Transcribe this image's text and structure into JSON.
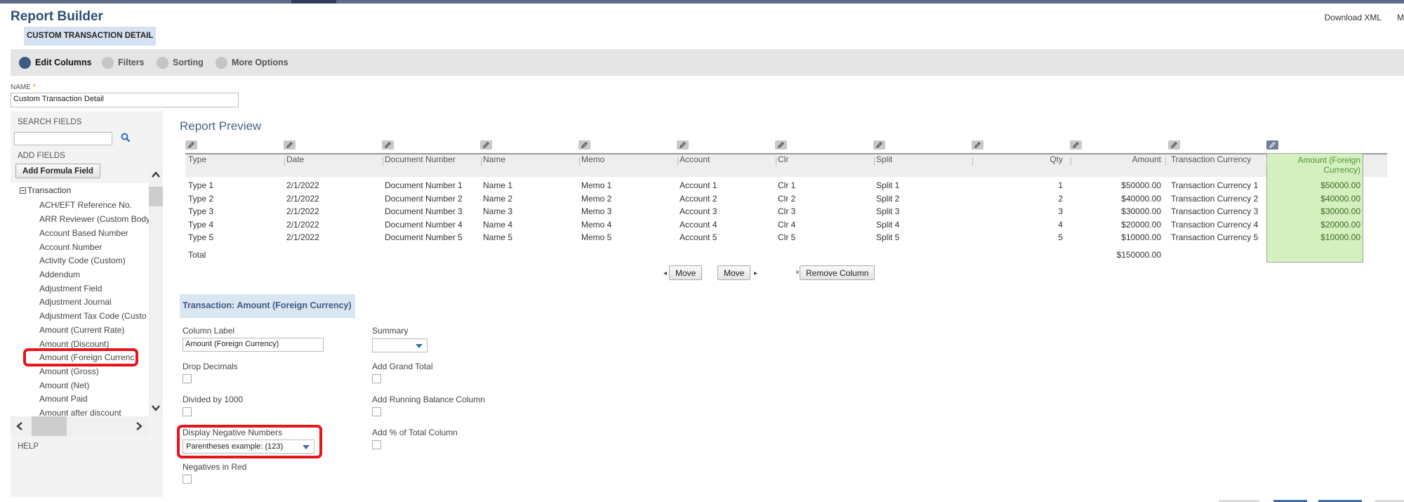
{
  "app": {
    "title": "Report Builder",
    "subtab": "CUSTOM TRANSACTION DETAIL",
    "header_links": [
      "Download XML",
      "M"
    ]
  },
  "steps": [
    {
      "label": "Edit Columns",
      "active": true
    },
    {
      "label": "Filters",
      "active": false
    },
    {
      "label": "Sorting",
      "active": false
    },
    {
      "label": "More Options",
      "active": false
    }
  ],
  "name_field": {
    "label": "NAME",
    "required_mark": "*",
    "value": "Custom Transaction Detail"
  },
  "sidebar": {
    "search_label": "SEARCH FIELDS",
    "search_value": "",
    "add_fields_label": "ADD FIELDS",
    "add_formula_label": "Add Formula Field",
    "group": "Transaction",
    "fields": [
      "ACH/EFT Reference No.",
      "ARR Reviewer (Custom Body",
      "Account Based Number",
      "Account Number",
      "Activity Code (Custom)",
      "Addendum",
      "Adjustment Field",
      "Adjustment Journal",
      "Adjustment Tax Code (Custo",
      "Amount (Current Rate)",
      "Amount (Discount)",
      "Amount (Foreign Currenc",
      "Amount (Gross)",
      "Amount (Net)",
      "Amount Paid",
      "Amount after discount"
    ],
    "help_label": "HELP"
  },
  "preview": {
    "title": "Report Preview",
    "columns": [
      "Type",
      "Date",
      "Document Number",
      "Name",
      "Memo",
      "Account",
      "Clr",
      "Split",
      "Qty",
      "Amount",
      "Transaction Currency",
      "Amount (Foreign Currency)"
    ],
    "selected_column_lines": [
      "Amount (Foreign",
      "Currency)"
    ],
    "rows": [
      [
        "Type 1",
        "2/1/2022",
        "Document Number 1",
        "Name 1",
        "Memo 1",
        "Account 1",
        "Clr 1",
        "Split 1",
        "1",
        "$50000.00",
        "Transaction Currency 1",
        "$50000.00"
      ],
      [
        "Type 2",
        "2/1/2022",
        "Document Number 2",
        "Name 2",
        "Memo 2",
        "Account 2",
        "Clr 2",
        "Split 2",
        "2",
        "$40000.00",
        "Transaction Currency 2",
        "$40000.00"
      ],
      [
        "Type 3",
        "2/1/2022",
        "Document Number 3",
        "Name 3",
        "Memo 3",
        "Account 3",
        "Clr 3",
        "Split 3",
        "3",
        "$30000.00",
        "Transaction Currency 3",
        "$30000.00"
      ],
      [
        "Type 4",
        "2/1/2022",
        "Document Number 4",
        "Name 4",
        "Memo 4",
        "Account 4",
        "Clr 4",
        "Split 4",
        "4",
        "$20000.00",
        "Transaction Currency 4",
        "$20000.00"
      ],
      [
        "Type 5",
        "2/1/2022",
        "Document Number 5",
        "Name 5",
        "Memo 5",
        "Account 5",
        "Clr 5",
        "Split 5",
        "5",
        "$10000.00",
        "Transaction Currency 5",
        "$10000.00"
      ]
    ],
    "total_label": "Total",
    "total_amount": "$150000.00",
    "buttons": {
      "move_left": "Move",
      "move_right": "Move",
      "remove": "Remove Column"
    }
  },
  "column_settings": {
    "section_title": "Transaction: Amount (Foreign Currency)",
    "column_label_label": "Column Label",
    "column_label_value": "Amount (Foreign Currency)",
    "summary_label": "Summary",
    "summary_value": "",
    "drop_decimals_label": "Drop Decimals",
    "add_grand_total_label": "Add Grand Total",
    "divided_label": "Divided by 1000",
    "running_balance_label": "Add Running Balance Column",
    "negative_label": "Display Negative Numbers",
    "negative_value": "Parentheses  example: (123)",
    "pct_total_label": "Add % of Total Column",
    "negatives_red_label": "Negatives in Red"
  },
  "colors": {
    "accent": "#3c5a82",
    "highlight": "#e8141b",
    "selected_column": "#d4f0bf"
  }
}
